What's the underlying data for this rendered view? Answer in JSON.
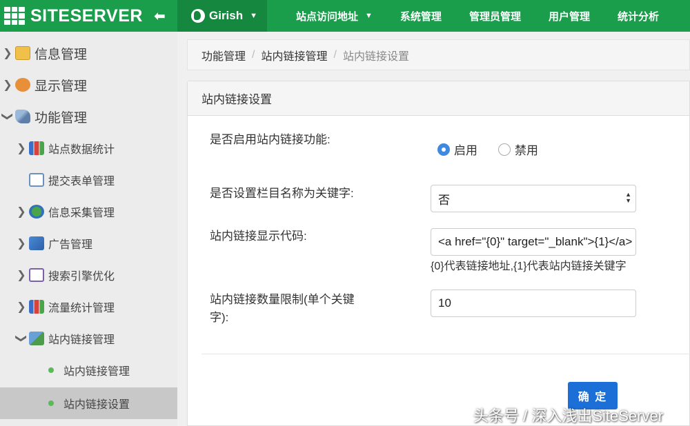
{
  "header": {
    "logo_text": "SITESERVER",
    "collapse_icon": "arrow-left-icon",
    "site_name": "Girish",
    "nav": [
      {
        "label": "站点访问地址",
        "has_caret": true
      },
      {
        "label": "系统管理"
      },
      {
        "label": "管理员管理"
      },
      {
        "label": "用户管理"
      },
      {
        "label": "统计分析"
      }
    ]
  },
  "sidebar": {
    "items": [
      {
        "label": "信息管理",
        "icon": "folder-icon"
      },
      {
        "label": "显示管理",
        "icon": "palette-icon"
      },
      {
        "label": "功能管理",
        "icon": "wrench-icon"
      },
      {
        "label": "站点数据统计",
        "icon": "bar-chart-icon"
      },
      {
        "label": "提交表单管理",
        "icon": "form-icon"
      },
      {
        "label": "信息采集管理",
        "icon": "globe-icon"
      },
      {
        "label": "广告管理",
        "icon": "flag-icon"
      },
      {
        "label": "搜索引擎优化",
        "icon": "line-chart-icon"
      },
      {
        "label": "流量统计管理",
        "icon": "bar-chart-icon"
      },
      {
        "label": "站内链接管理",
        "icon": "link-icon"
      },
      {
        "label": "站内链接管理"
      },
      {
        "label": "站内链接设置"
      }
    ]
  },
  "breadcrumb": {
    "items": [
      "功能管理",
      "站内链接管理",
      "站内链接设置"
    ],
    "separator": "/"
  },
  "panel": {
    "title": "站内链接设置",
    "enable": {
      "label": "是否启用站内链接功能:",
      "option_on": "启用",
      "option_off": "禁用",
      "selected": "启用"
    },
    "column_keyword": {
      "label": "是否设置栏目名称为关键字:",
      "value": "否"
    },
    "display_code": {
      "label": "站内链接显示代码:",
      "value": "<a href=\"{0}\" target=\"_blank\">{1}</a>",
      "hint": "{0}代表链接地址,{1}代表站内链接关键字"
    },
    "limit": {
      "label_line1": "站内链接数量限制(单个关键",
      "label_line2": "字):",
      "value": "10"
    },
    "submit_label": "确 定"
  },
  "watermark": "头条号 / 深入浅出SiteServer",
  "colors": {
    "topbar": "#1b9e4b",
    "site_switch": "#16873f",
    "primary_button": "#1b6fd6",
    "radio_checked": "#3f8ae0",
    "sidebar_active": "#c8c8c8"
  }
}
